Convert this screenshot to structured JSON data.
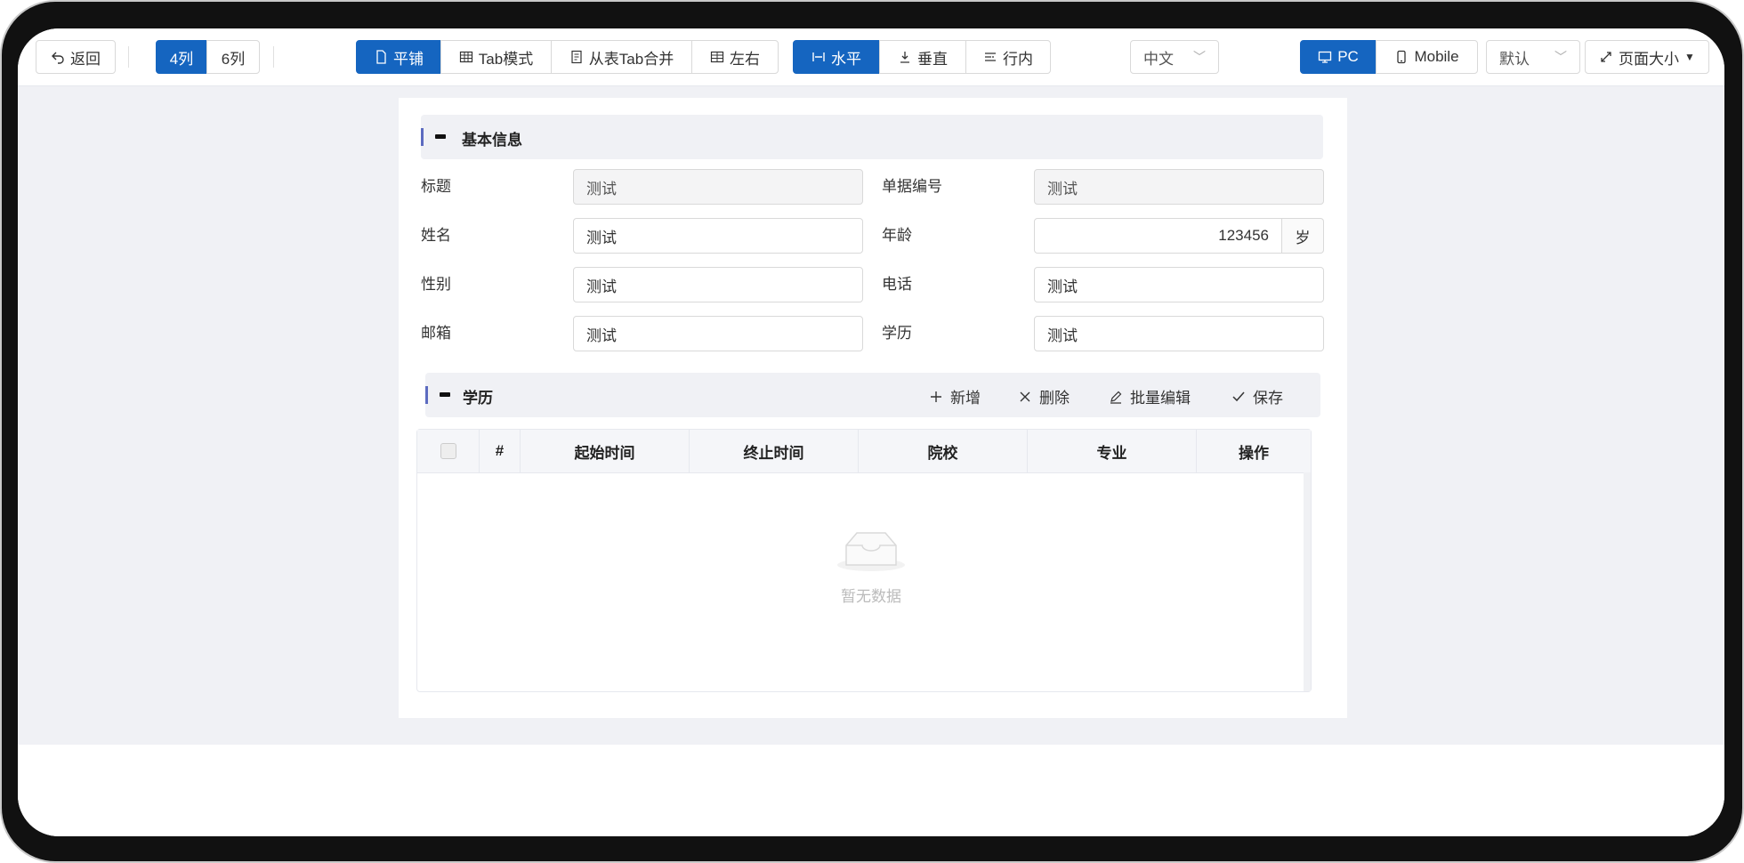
{
  "toolbar": {
    "back_label": "返回",
    "col4_label": "4列",
    "col6_label": "6列",
    "layout_tile_label": "平铺",
    "layout_tab_label": "Tab模式",
    "layout_merge_label": "从表Tab合并",
    "layout_lr_label": "左右",
    "align_h_label": "水平",
    "align_v_label": "垂直",
    "align_inline_label": "行内",
    "language_value": "中文",
    "device_pc_label": "PC",
    "device_mobile_label": "Mobile",
    "theme_value": "默认",
    "page_size_label": "页面大小",
    "accent_color": "#1565c0"
  },
  "basic_info": {
    "section_title": "基本信息",
    "fields": [
      {
        "label": "标题",
        "value": "测试"
      },
      {
        "label": "单据编号",
        "value": "测试"
      },
      {
        "label": "姓名",
        "value": "测试"
      },
      {
        "label": "年龄",
        "value": "123456",
        "suffix": "岁"
      },
      {
        "label": "性别",
        "value": "测试"
      },
      {
        "label": "电话",
        "value": "测试"
      },
      {
        "label": "邮箱",
        "value": "测试"
      },
      {
        "label": "学历",
        "value": "测试"
      }
    ]
  },
  "education": {
    "section_title": "学历",
    "actions": {
      "add_label": "新增",
      "delete_label": "删除",
      "batch_edit_label": "批量编辑",
      "save_label": "保存"
    },
    "table": {
      "columns": [
        "#",
        "起始时间",
        "终止时间",
        "院校",
        "专业",
        "操作"
      ],
      "rows": [],
      "empty_text": "暂无数据"
    }
  }
}
